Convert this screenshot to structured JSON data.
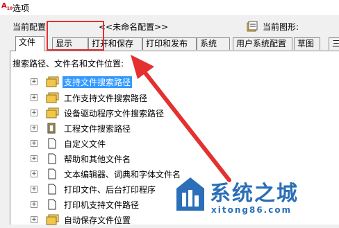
{
  "window": {
    "title": "选项",
    "icon": "autocad-icon"
  },
  "config": {
    "label": "当前配置:",
    "name": "<<未命名配置>>",
    "drawing_label": "当前图形:"
  },
  "tabs": [
    {
      "label": "文件",
      "active": true
    },
    {
      "label": "显示",
      "active": false
    },
    {
      "label": "打开和保存",
      "active": false
    },
    {
      "label": "打印和发布",
      "active": false
    },
    {
      "label": "系统",
      "active": false
    },
    {
      "label": "用户系统配置",
      "active": false
    },
    {
      "label": "草图",
      "active": false
    },
    {
      "label": "三",
      "active": false
    }
  ],
  "tree": {
    "label": "搜索路径、文件名和文件位置:",
    "items": [
      {
        "label": "支持文件搜索路径",
        "icon": "folder-stack-icon",
        "selected": true
      },
      {
        "label": "工作支持文件搜索路径",
        "icon": "folder-stack-icon",
        "selected": false
      },
      {
        "label": "设备驱动程序文件搜索路径",
        "icon": "folder-stack-icon",
        "selected": false
      },
      {
        "label": "工程文件搜索路径",
        "icon": "project-icon",
        "selected": false
      },
      {
        "label": "自定义文件",
        "icon": "file-icon",
        "selected": false
      },
      {
        "label": "帮助和其他文件名",
        "icon": "file-icon",
        "selected": false
      },
      {
        "label": "文本编辑器、词典和字体文件名",
        "icon": "file-icon",
        "selected": false
      },
      {
        "label": "打印文件、后台打印程序",
        "icon": "file-icon",
        "selected": false
      },
      {
        "label": "打印机支持文件路径",
        "icon": "file-icon",
        "selected": false
      },
      {
        "label": "自动保存文件位置",
        "icon": "folder-stack-icon",
        "selected": false
      }
    ]
  },
  "watermark": {
    "text": "系统之城",
    "url": "xitong86.com",
    "color": "#2a6fb7"
  },
  "annotation": {
    "color": "#e53030"
  }
}
